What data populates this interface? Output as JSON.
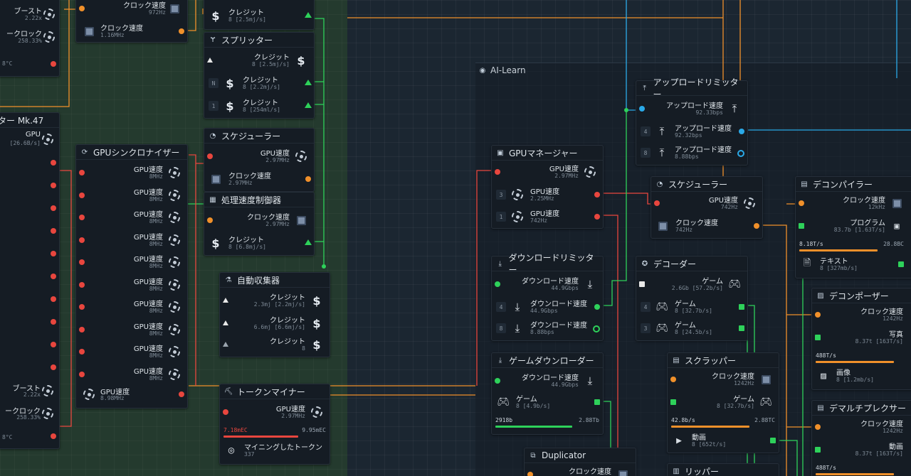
{
  "zone": {
    "title": "AI-Learn"
  },
  "nodes": {
    "a1": {
      "r1": "ブースト",
      "r1s": "2.22x",
      "r2": "ークロック",
      "r2s": "258.33%",
      "r3s": "8°C"
    },
    "a2": {
      "title": "ター Mk.47",
      "r1": "GPU",
      "r1s": "[26.6B/s]",
      "b1": "ブースト",
      "b1s": "2.22x",
      "b2": "ークロック",
      "b2s": "258.33%",
      "b3s": "8°C"
    },
    "b0": {
      "r1": "クロック速度",
      "r1s": "972Hz",
      "r2": "クロック速度",
      "r2s": "1.16MHz"
    },
    "b1": {
      "title": "GPUシンクロナイザー",
      "gpu_label": "GPU速度",
      "gpu_sub": "8MHz",
      "out": "GPU速度",
      "out_sub": "8.98MHz"
    },
    "c0": {
      "r1": "クレジット",
      "r1s": "8 [2.5mj/s]"
    },
    "c1": {
      "title": "スプリッター",
      "r1": "クレジット",
      "r1s": "8 [2.5mj/s]",
      "r2": "クレジット",
      "r2s": "8 [2.2mj/s]",
      "r3": "クレジット",
      "r3s": "8 [254ml/s]"
    },
    "c2": {
      "title": "スケジューラー",
      "r1": "GPU速度",
      "r1s": "2.97MHz",
      "r2": "クロック速度",
      "r2s": "2.97MHz"
    },
    "c3": {
      "title": "処理速度制御器",
      "r1": "クロック速度",
      "r1s": "2.97MHz",
      "r2": "クレジット",
      "r2s": "8 [6.8mj/s]"
    },
    "c4": {
      "title": "自動収集器",
      "r1": "クレジット",
      "r1s": "2.3mj [2.2mj/s]",
      "r2": "クレジット",
      "r2s": "6.6mj [6.6mj/s]",
      "r3": "クレジット",
      "r3s": "8"
    },
    "c5": {
      "title": "トークンマイナー",
      "r1": "GPU速度",
      "r1s": "2.97MHz",
      "bar_l": "7.18mEC",
      "bar_r": "9.95mEC",
      "r2": "マイニングしたトークン",
      "r2s": "337"
    },
    "d1": {
      "title": "GPUマネージャー",
      "r1": "GPU速度",
      "r1s": "2.97MHz",
      "r2": "GPU速度",
      "r2s": "2.25MHz",
      "r3": "GPU速度",
      "r3s": "742Hz"
    },
    "d2": {
      "title": "ダウンロードリミッター",
      "r1": "ダウンロード速度",
      "r1s": "44.9Gbps",
      "r2": "ダウンロード速度",
      "r2s": "44.9Gbps",
      "r3": "ダウンロード速度",
      "r3s": "8.88bps"
    },
    "d3": {
      "title": "ゲームダウンローダー",
      "r1": "ダウンロード速度",
      "r1s": "44.9Gbps",
      "r2": "ゲーム",
      "r2s": "8 [4.9b/s]",
      "bar_l": "2918b",
      "bar_r": "2.88Tb"
    },
    "d4": {
      "title": "Duplicator",
      "r1": "クロック速度"
    },
    "e1": {
      "title": "アップロードリミッター",
      "r1": "アップロード速度",
      "r1s": "92.33bps",
      "r2": "アップロード速度",
      "r2s": "92.32bps",
      "r3": "アップロード速度",
      "r3s": "8.88bps"
    },
    "e2": {
      "title": "スケジューラー",
      "r1": "GPU速度",
      "r1s": "742Hz",
      "r2": "クロック速度",
      "r2s": "742Hz"
    },
    "e3": {
      "title": "デコーダー",
      "r1": "ゲーム",
      "r1s": "2.6Gb [57.2b/s]",
      "r2": "ゲーム",
      "r2s": "8 [32.7b/s]",
      "r3": "ゲーム",
      "r3s": "8 [24.5b/s]"
    },
    "e4": {
      "title": "スクラッパー",
      "r1": "クロック速度",
      "r1s": "1242Hz",
      "r2": "ゲーム",
      "r2s": "8 [32.7b/s]",
      "bar_l": "42.8b/s",
      "bar_r": "2.88TC",
      "r3": "動画",
      "r3s": "8 [652t/s]"
    },
    "e5": {
      "title": "リッパー"
    },
    "f1": {
      "title": "デコンパイラー",
      "r1": "クロック速度",
      "r1s": "12kHz",
      "r2": "プログラム",
      "r2s": "83.7b [1.63T/s]",
      "bar_l": "8.18T/s",
      "bar_r": "28.8BC",
      "r3": "テキスト",
      "r3s": "8 [327mb/s]"
    },
    "f2": {
      "title": "デコンポーザー",
      "r1": "クロック速度",
      "r1s": "1242Hz",
      "r2": "写真",
      "r2s": "8.37t [163T/s]",
      "bar_l": "488T/s",
      "r3": "画像",
      "r3s": "8 [1.2mb/s]"
    },
    "f3": {
      "title": "デマルチプレクサー",
      "r1": "クロック速度",
      "r1s": "1242Hz",
      "r2": "動画",
      "r2s": "8.37t [163T/s]",
      "bar_l": "488T/s"
    }
  },
  "colors": {
    "wire_orange": "#f0902a",
    "wire_red": "#e8463e",
    "wire_green": "#2ed15a",
    "wire_cyan": "#2aa9e8",
    "bg": "#1b2631"
  }
}
